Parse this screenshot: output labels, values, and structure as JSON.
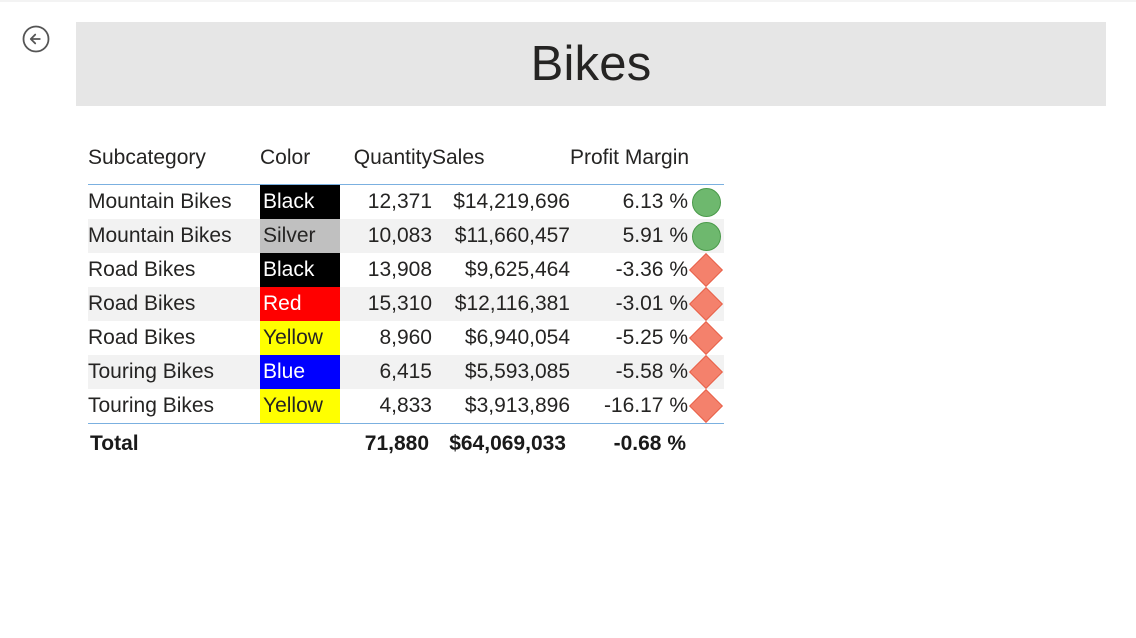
{
  "page": {
    "title": "Bikes",
    "back_icon": "back-arrow-circle-icon",
    "banner_bg": "#e6e6e6",
    "header_rule_color": "#7bb0e0",
    "alt_row_bg": "#f2f2f2"
  },
  "table": {
    "columns": [
      {
        "key": "subcategory",
        "label": "Subcategory",
        "align": "left"
      },
      {
        "key": "color",
        "label": "Color",
        "align": "left"
      },
      {
        "key": "quantity",
        "label": "Quantity",
        "align": "right"
      },
      {
        "key": "sales",
        "label": "Sales",
        "align": "left"
      },
      {
        "key": "profit_margin",
        "label": "Profit Margin",
        "align": "right"
      },
      {
        "key": "kpi",
        "label": "",
        "align": "center"
      }
    ],
    "rows": [
      {
        "subcategory": "Mountain Bikes",
        "color": "Black",
        "color_bg": "#000000",
        "color_fg": "#ffffff",
        "quantity": "12,371",
        "sales": "$14,219,696",
        "profit_margin": "6.13 %",
        "kpi_shape": "circle",
        "kpi_fill": "#6eb86e",
        "kpi_stroke": "#4a9a4a"
      },
      {
        "subcategory": "Mountain Bikes",
        "color": "Silver",
        "color_bg": "#c0c0c0",
        "color_fg": "#252423",
        "quantity": "10,083",
        "sales": "$11,660,457",
        "profit_margin": "5.91 %",
        "kpi_shape": "circle",
        "kpi_fill": "#6eb86e",
        "kpi_stroke": "#4a9a4a"
      },
      {
        "subcategory": "Road Bikes",
        "color": "Black",
        "color_bg": "#000000",
        "color_fg": "#ffffff",
        "quantity": "13,908",
        "sales": "$9,625,464",
        "profit_margin": "-3.36 %",
        "kpi_shape": "diamond",
        "kpi_fill": "#f4816c",
        "kpi_stroke": "#e8614a"
      },
      {
        "subcategory": "Road Bikes",
        "color": "Red",
        "color_bg": "#ff0000",
        "color_fg": "#ffffff",
        "quantity": "15,310",
        "sales": "$12,116,381",
        "profit_margin": "-3.01 %",
        "kpi_shape": "diamond",
        "kpi_fill": "#f4816c",
        "kpi_stroke": "#e8614a"
      },
      {
        "subcategory": "Road Bikes",
        "color": "Yellow",
        "color_bg": "#ffff00",
        "color_fg": "#252423",
        "quantity": "8,960",
        "sales": "$6,940,054",
        "profit_margin": "-5.25 %",
        "kpi_shape": "diamond",
        "kpi_fill": "#f4816c",
        "kpi_stroke": "#e8614a"
      },
      {
        "subcategory": "Touring Bikes",
        "color": "Blue",
        "color_bg": "#0000ff",
        "color_fg": "#ffffff",
        "quantity": "6,415",
        "sales": "$5,593,085",
        "profit_margin": "-5.58 %",
        "kpi_shape": "diamond",
        "kpi_fill": "#f4816c",
        "kpi_stroke": "#e8614a"
      },
      {
        "subcategory": "Touring Bikes",
        "color": "Yellow",
        "color_bg": "#ffff00",
        "color_fg": "#252423",
        "quantity": "4,833",
        "sales": "$3,913,896",
        "profit_margin": "-16.17 %",
        "kpi_shape": "diamond",
        "kpi_fill": "#f4816c",
        "kpi_stroke": "#e8614a"
      }
    ],
    "total": {
      "subcategory": "Total",
      "color": "",
      "quantity": "71,880",
      "sales": "$64,069,033",
      "profit_margin": "-0.68 %",
      "kpi_shape": "none"
    }
  }
}
